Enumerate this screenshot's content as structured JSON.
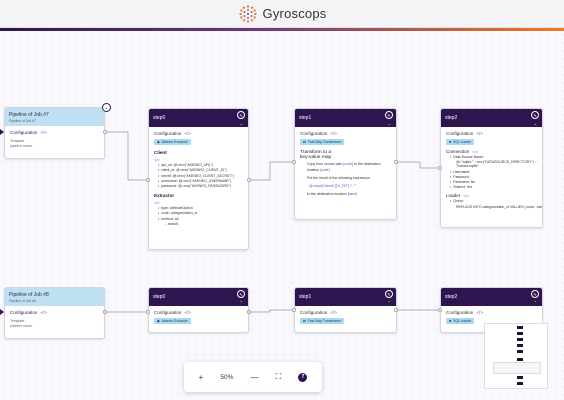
{
  "app": {
    "name": "Gyroscops"
  },
  "jobs": [
    {
      "title": "Pipeline of Job #7",
      "subtitle": "Pipeline of Job #7",
      "config": "Configuration",
      "code": "</>",
      "extra": "Template :",
      "extra2": "pipeline name :"
    },
    {
      "title": "Pipeline of Job #8",
      "subtitle": "Pipeline of Job #8",
      "config": "Configuration",
      "code": "</>",
      "extra": "Template :",
      "extra2": "pipeline name :"
    }
  ],
  "steps_top": [
    {
      "title": "step0",
      "config": "Configuration",
      "code": "</>",
      "pill": "Akeneo Extractor",
      "client_title": "Client",
      "client_code": "</>",
      "client_items": [
        "api_url: @=env(\"AKENEO_URL\")",
        "client_id: @=env(\"AKENEO_CLIENT_ID\")",
        "secret: @=env(\"AKENEO_CLIENT_SECRET\")",
        "username: @=env(\"AKENEO_USERNAME\")",
        "password: @=env(\"AKENEO_PASSWORD\")"
      ],
      "extractor_title": "Extractor",
      "extractor_code": "</>",
      "extractor_items": [
        "type: attributeOption",
        "code: categorization_ct",
        "method: all",
        "... search"
      ]
    },
    {
      "title": "step1",
      "config": "Configuration",
      "code": "</>",
      "pill": "Fast Map Transformer",
      "transform_title": "Transform to a key-value map",
      "copy_line1": "Copy from source path",
      "copy_tag1": "[code]",
      "copy_line1b": "to the destination",
      "copy_line2": "location",
      "copy_tag2": "[code]",
      "put_line": "Put the result of the following expression",
      "expr": "@=input[\"labels\"][\"fr_FR\"] ?: \"\"",
      "dest_line": "to the destination location",
      "dest_tag": "[label]"
    },
    {
      "title": "step2",
      "config": "Configuration",
      "code": "</>",
      "pill": "SQL Loader",
      "conn_title": "Connection",
      "conn_code": "</>",
      "conn_items": [
        "Data Source Name:",
        "@=\"sqlite:\" ~ env(\"DATASOURCE_DIRECTORY\") ~ \"/values.sqlite\"",
        "Username:",
        "Password:",
        "Persistent: No",
        "Shared: Yes"
      ],
      "loader_title": "Loader",
      "loader_code": "</>",
      "loader_items": [
        "Query:",
        "REPLACE INTO categorization_ct VALUES (:code, :label)"
      ]
    }
  ],
  "steps_bottom": [
    {
      "title": "step0",
      "config": "Configuration",
      "code": "</>",
      "pill": "Akeneo Extractor"
    },
    {
      "title": "step1",
      "config": "Configuration",
      "code": "</>",
      "pill": "Fast Map Transformer"
    },
    {
      "title": "step2",
      "config": "Configuration",
      "code": "</>",
      "pill": "SQL Loader"
    }
  ],
  "controls": {
    "zoom_in": "+",
    "zoom": "50%",
    "zoom_out": "—",
    "fit": "⛶",
    "help": "?"
  },
  "icons": {
    "edit": "pencil-circle-icon",
    "chevron": "chevron-down-icon",
    "collapse": "chevron-down-circle-icon"
  },
  "colors": {
    "header_dark": "#2e1550",
    "job_head": "#bfe0f3",
    "pill": "#a8dbf2",
    "accent": "#7b4bc4"
  }
}
